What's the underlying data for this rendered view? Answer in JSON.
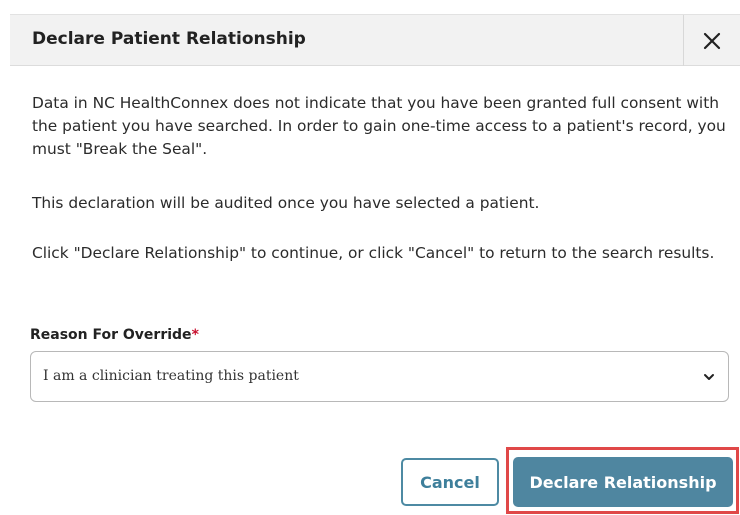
{
  "dialog": {
    "title": "Declare Patient Relationship",
    "close_icon": "close-icon"
  },
  "body": {
    "paragraph1": "Data in NC HealthConnex does not indicate that you have been granted full consent with the patient you have searched. In order to gain one-time access to a patient's record, you must \"Break the Seal\".",
    "paragraph2": "This declaration will be audited once you have selected a patient.",
    "paragraph3": "Click \"Declare Relationship\" to continue, or click \"Cancel\" to return to the search results."
  },
  "form": {
    "reason_label": "Reason For Override",
    "required_marker": "*",
    "reason_selected": "I am a clinician treating this patient",
    "chevron_icon": "chevron-down-icon"
  },
  "buttons": {
    "cancel_label": "Cancel",
    "declare_label": "Declare Relationship"
  },
  "colors": {
    "primary": "#4f86a0",
    "cancel_border": "#4d8aa3",
    "highlight": "#e04848",
    "required": "#c8102e",
    "header_bg": "#f2f2f2"
  }
}
